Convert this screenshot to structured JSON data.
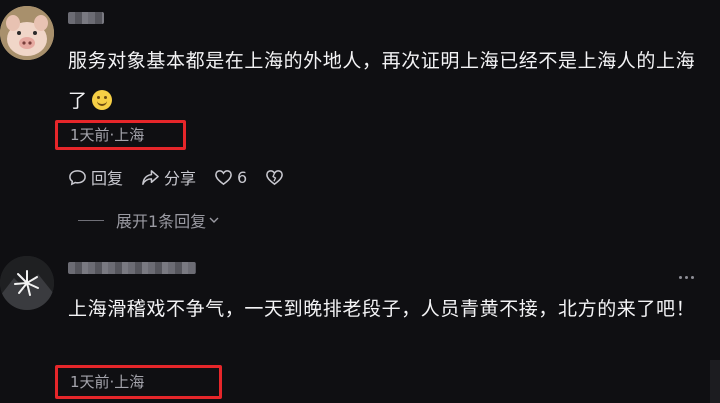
{
  "comments": [
    {
      "avatar_icon": "pig-avatar-icon",
      "text": "服务对象基本都是在上海的外地人，再次证明上海已经不是上海人的上海了",
      "emoji": "smile-emoji",
      "meta": "1天前·上海",
      "actions": {
        "reply_label": "回复",
        "share_label": "分享",
        "like_count": "6"
      },
      "expand_replies": "展开1条回复"
    },
    {
      "avatar_icon": "dark-sparkle-avatar-icon",
      "text": "上海滑稽戏不争气，一天到晚排老段子，人员青黄不接，北方的来了吧！",
      "meta": "1天前·上海"
    }
  ],
  "colors": {
    "background": "#0f0f12",
    "highlight_box": "#e6262a"
  }
}
